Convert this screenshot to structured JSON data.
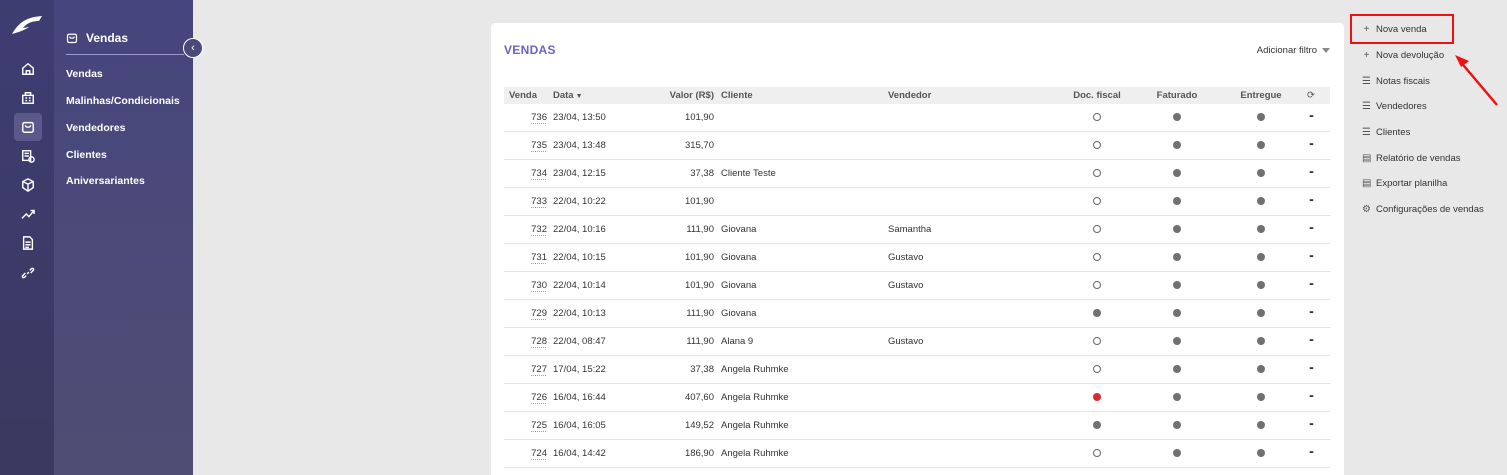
{
  "rail": {
    "icons": [
      "home-icon",
      "building-icon",
      "bag-icon",
      "cash-icon",
      "box-icon",
      "trend-icon",
      "document-icon",
      "link-icon"
    ]
  },
  "sidebar": {
    "title": "Vendas",
    "items": [
      {
        "label": "Vendas"
      },
      {
        "label": "Malinhas/Condicionais"
      },
      {
        "label": "Vendedores"
      },
      {
        "label": "Clientes"
      },
      {
        "label": "Aniversariantes"
      }
    ]
  },
  "main": {
    "title": "VENDAS",
    "filter_label": "Adicionar filtro",
    "columns": {
      "venda": "Venda",
      "data": "Data",
      "valor": "Valor (R$)",
      "cliente": "Cliente",
      "vendedor": "Vendedor",
      "doc": "Doc. fiscal",
      "faturado": "Faturado",
      "entregue": "Entregue"
    },
    "rows": [
      {
        "venda": "736",
        "data": "23/04, 13:50",
        "valor": "101,90",
        "cliente": "",
        "vendedor": "",
        "doc": "empty",
        "fat": "gray",
        "ent": "gray"
      },
      {
        "venda": "735",
        "data": "23/04, 13:48",
        "valor": "315,70",
        "cliente": "",
        "vendedor": "",
        "doc": "empty",
        "fat": "gray",
        "ent": "gray"
      },
      {
        "venda": "734",
        "data": "23/04, 12:15",
        "valor": "37,38",
        "cliente": "Cliente Teste",
        "vendedor": "",
        "doc": "empty",
        "fat": "gray",
        "ent": "gray"
      },
      {
        "venda": "733",
        "data": "22/04, 10:22",
        "valor": "101,90",
        "cliente": "",
        "vendedor": "",
        "doc": "empty",
        "fat": "gray",
        "ent": "gray"
      },
      {
        "venda": "732",
        "data": "22/04, 10:16",
        "valor": "111,90",
        "cliente": "Giovana",
        "vendedor": "Samantha",
        "doc": "empty",
        "fat": "gray",
        "ent": "gray"
      },
      {
        "venda": "731",
        "data": "22/04, 10:15",
        "valor": "101,90",
        "cliente": "Giovana",
        "vendedor": "Gustavo",
        "doc": "empty",
        "fat": "gray",
        "ent": "gray"
      },
      {
        "venda": "730",
        "data": "22/04, 10:14",
        "valor": "101,90",
        "cliente": "Giovana",
        "vendedor": "Gustavo",
        "doc": "empty",
        "fat": "gray",
        "ent": "gray"
      },
      {
        "venda": "729",
        "data": "22/04, 10:13",
        "valor": "111,90",
        "cliente": "Giovana",
        "vendedor": "",
        "doc": "gray",
        "fat": "gray",
        "ent": "gray"
      },
      {
        "venda": "728",
        "data": "22/04, 08:47",
        "valor": "111,90",
        "cliente": "Alana 9",
        "vendedor": "Gustavo",
        "doc": "empty",
        "fat": "gray",
        "ent": "gray"
      },
      {
        "venda": "727",
        "data": "17/04, 15:22",
        "valor": "37,38",
        "cliente": "Angela Ruhmke",
        "vendedor": "",
        "doc": "empty",
        "fat": "gray",
        "ent": "gray"
      },
      {
        "venda": "726",
        "data": "16/04, 16:44",
        "valor": "407,60",
        "cliente": "Angela Ruhmke",
        "vendedor": "",
        "doc": "red",
        "fat": "gray",
        "ent": "gray"
      },
      {
        "venda": "725",
        "data": "16/04, 16:05",
        "valor": "149,52",
        "cliente": "Angela Ruhmke",
        "vendedor": "",
        "doc": "gray",
        "fat": "gray",
        "ent": "gray"
      },
      {
        "venda": "724",
        "data": "16/04, 14:42",
        "valor": "186,90",
        "cliente": "Angela Ruhmke",
        "vendedor": "",
        "doc": "empty",
        "fat": "gray",
        "ent": "gray"
      }
    ]
  },
  "actions": [
    {
      "label": "Nova venda",
      "icon": "plus-icon",
      "glyph": "+"
    },
    {
      "label": "Nova devolução",
      "icon": "plus-icon",
      "glyph": "+"
    },
    {
      "label": "Notas fiscais",
      "icon": "list-icon",
      "glyph": "☰"
    },
    {
      "label": "Vendedores",
      "icon": "list-icon",
      "glyph": "☰"
    },
    {
      "label": "Clientes",
      "icon": "list-icon",
      "glyph": "☰"
    },
    {
      "label": "Relatório de vendas",
      "icon": "file-icon",
      "glyph": "▤"
    },
    {
      "label": "Exportar planilha",
      "icon": "file-icon",
      "glyph": "▤"
    },
    {
      "label": "Configurações de vendas",
      "icon": "gear-icon",
      "glyph": "⚙"
    }
  ],
  "colors": {
    "accent": "#6b63c6",
    "highlight": "#e11111",
    "status_red": "#d32f2f"
  }
}
